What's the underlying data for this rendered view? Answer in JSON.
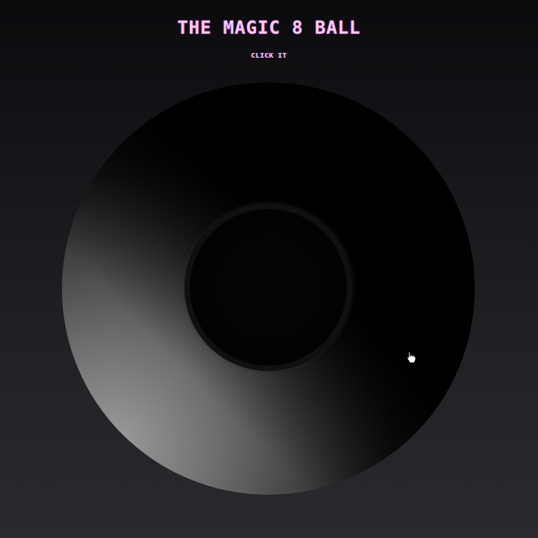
{
  "header": {
    "title": "THE MAGIC 8 BALL",
    "subtitle": "CLICK IT"
  },
  "ball": {
    "answer": ""
  },
  "icons": {
    "cursor": "hand-pointer-icon"
  },
  "colors": {
    "title_text": "#f3cde6",
    "shadow_blue": "#3a2bd6",
    "shadow_red": "#c0174c"
  }
}
